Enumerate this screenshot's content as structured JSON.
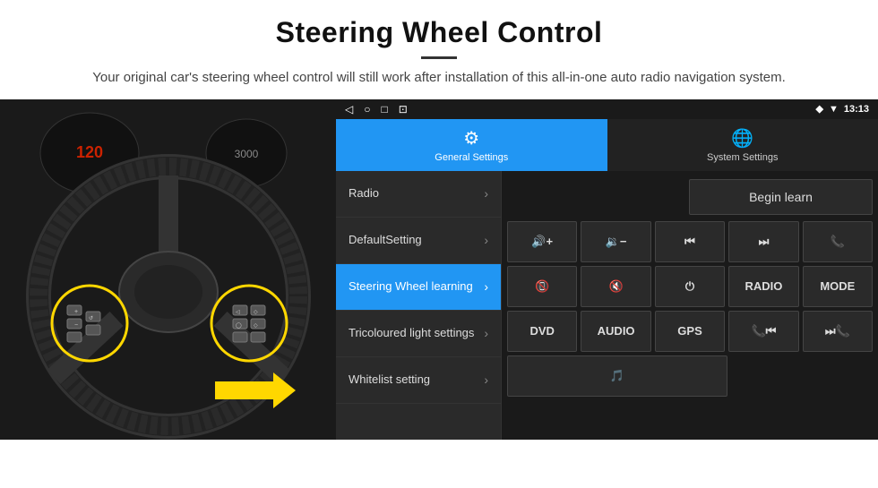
{
  "header": {
    "title": "Steering Wheel Control",
    "subtitle": "Your original car's steering wheel control will still work after installation of this all-in-one auto radio navigation system."
  },
  "status_bar": {
    "icons": [
      "◁",
      "○",
      "□",
      "⊡"
    ],
    "right_icons": [
      "◆",
      "▼"
    ],
    "time": "13:13"
  },
  "tabs": [
    {
      "id": "general",
      "label": "General Settings",
      "icon": "⚙",
      "active": true
    },
    {
      "id": "system",
      "label": "System Settings",
      "icon": "🌐",
      "active": false
    }
  ],
  "menu_items": [
    {
      "id": "radio",
      "label": "Radio",
      "active": false
    },
    {
      "id": "default",
      "label": "DefaultSetting",
      "active": false
    },
    {
      "id": "steering",
      "label": "Steering Wheel learning",
      "active": true
    },
    {
      "id": "tricoloured",
      "label": "Tricoloured light settings",
      "active": false
    },
    {
      "id": "whitelist",
      "label": "Whitelist setting",
      "active": false
    }
  ],
  "begin_learn_label": "Begin learn",
  "control_buttons": {
    "row1": [
      {
        "id": "vol-up",
        "label": "🔊+",
        "symbol": "vol+"
      },
      {
        "id": "vol-down",
        "label": "🔉−",
        "symbol": "vol-"
      },
      {
        "id": "prev-track",
        "label": "⏮",
        "symbol": "prev"
      },
      {
        "id": "next-track",
        "label": "⏭",
        "symbol": "next"
      },
      {
        "id": "phone",
        "label": "📞",
        "symbol": "phone"
      }
    ],
    "row2": [
      {
        "id": "hangup",
        "label": "📵",
        "symbol": "hangup"
      },
      {
        "id": "mute",
        "label": "🔇",
        "symbol": "mute"
      },
      {
        "id": "power",
        "label": "⏻",
        "symbol": "power"
      },
      {
        "id": "radio-btn",
        "label": "RADIO",
        "symbol": "RADIO"
      },
      {
        "id": "mode",
        "label": "MODE",
        "symbol": "MODE"
      }
    ],
    "row3": [
      {
        "id": "dvd",
        "label": "DVD",
        "symbol": "DVD"
      },
      {
        "id": "audio",
        "label": "AUDIO",
        "symbol": "AUDIO"
      },
      {
        "id": "gps",
        "label": "GPS",
        "symbol": "GPS"
      },
      {
        "id": "phone-prev",
        "label": "📞⏮",
        "symbol": "tel-prev"
      },
      {
        "id": "phone-next",
        "label": "⏭📞",
        "symbol": "tel-next"
      }
    ],
    "row4": [
      {
        "id": "media",
        "label": "🎵",
        "symbol": "media"
      }
    ]
  }
}
